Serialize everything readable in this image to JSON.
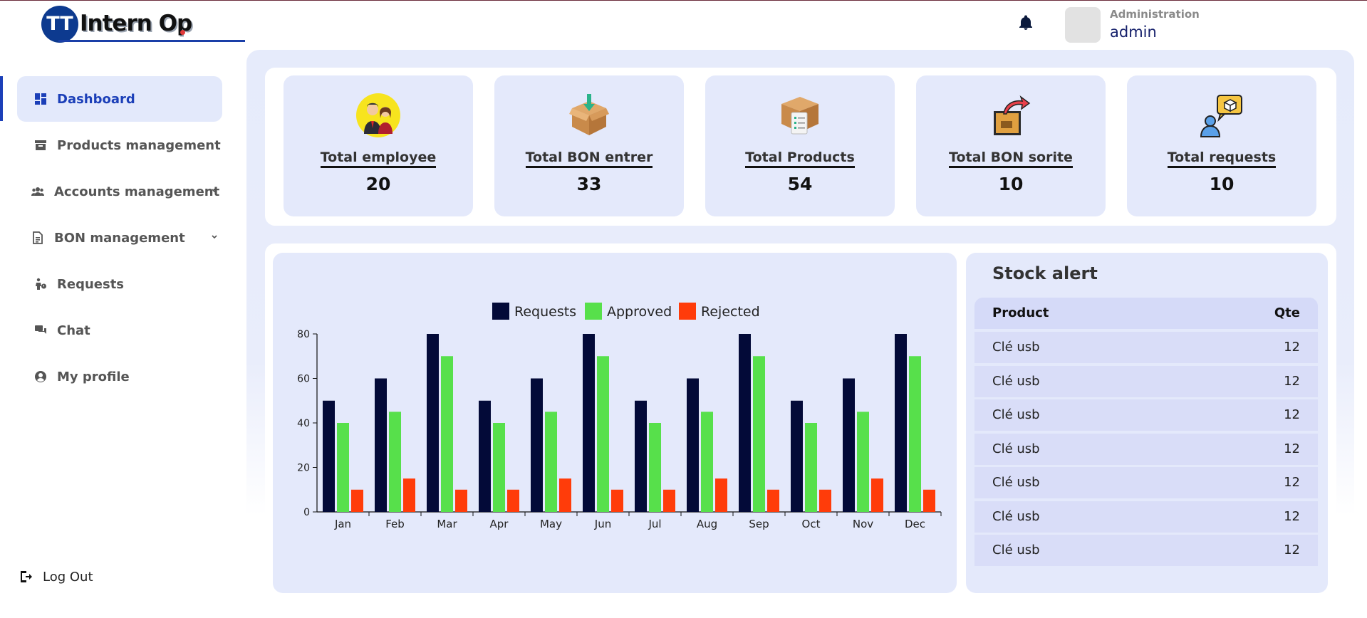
{
  "app": {
    "logo_mark": "TT",
    "logo_text": "Intern Op"
  },
  "header": {
    "user_role": "Administration",
    "user_name": "admin"
  },
  "sidebar": {
    "items": [
      {
        "label": "Dashboard",
        "icon": "dashboard-icon",
        "active": true
      },
      {
        "label": "Products management",
        "icon": "archive-icon"
      },
      {
        "label": "Accounts management",
        "icon": "users-icon",
        "expandable": true
      },
      {
        "label": "BON management",
        "icon": "document-icon",
        "expandable": true
      },
      {
        "label": "Requests",
        "icon": "person-request-icon"
      },
      {
        "label": "Chat",
        "icon": "chat-icon"
      },
      {
        "label": "My profile",
        "icon": "user-circle-icon"
      }
    ],
    "logout_label": "Log Out"
  },
  "stats": [
    {
      "label": "Total employee",
      "value": "20",
      "icon": "employees-icon"
    },
    {
      "label": "Total BON entrer",
      "value": "33",
      "icon": "box-in-icon"
    },
    {
      "label": "Total Products",
      "value": "54",
      "icon": "products-box-icon"
    },
    {
      "label": "Total BON sorite",
      "value": "10",
      "icon": "box-out-icon"
    },
    {
      "label": "Total requests",
      "value": "10",
      "icon": "request-chat-icon"
    }
  ],
  "chart_data": {
    "type": "bar",
    "categories": [
      "Jan",
      "Feb",
      "Mar",
      "Apr",
      "May",
      "Jun",
      "Jul",
      "Aug",
      "Sep",
      "Oct",
      "Nov",
      "Dec"
    ],
    "series": [
      {
        "name": "Requests",
        "color": "#030a38",
        "values": [
          50,
          60,
          80,
          50,
          60,
          80,
          50,
          60,
          80,
          50,
          60,
          80
        ]
      },
      {
        "name": "Approved",
        "color": "#57e04b",
        "values": [
          40,
          45,
          70,
          40,
          45,
          70,
          40,
          45,
          70,
          40,
          45,
          70
        ]
      },
      {
        "name": "Rejected",
        "color": "#ff3c0a",
        "values": [
          10,
          15,
          10,
          10,
          15,
          10,
          10,
          15,
          10,
          10,
          15,
          10
        ]
      }
    ],
    "ylim": [
      0,
      80
    ],
    "yticks": [
      0,
      20,
      40,
      60,
      80
    ],
    "legend": "top-center"
  },
  "stock_alert": {
    "title": "Stock alert",
    "columns": [
      "Product",
      "Qte"
    ],
    "rows": [
      [
        "Clé usb",
        "12"
      ],
      [
        "Clé usb",
        "12"
      ],
      [
        "Clé usb",
        "12"
      ],
      [
        "Clé usb",
        "12"
      ],
      [
        "Clé usb",
        "12"
      ],
      [
        "Clé usb",
        "12"
      ],
      [
        "Clé usb",
        "12"
      ]
    ]
  }
}
